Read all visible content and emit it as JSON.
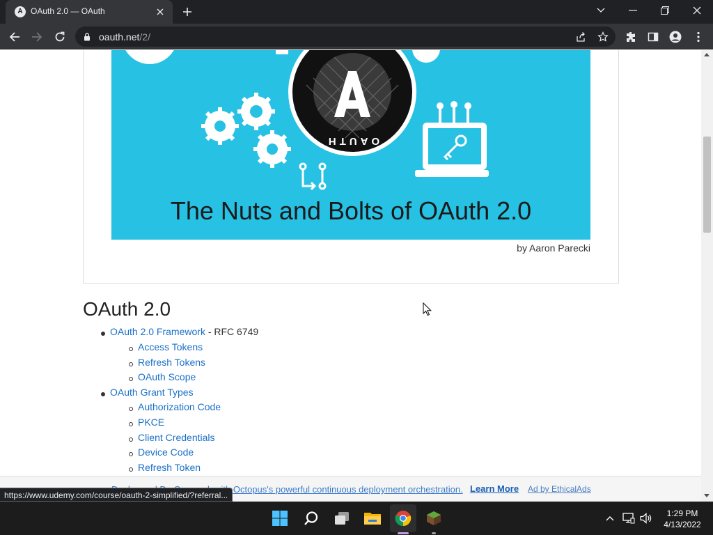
{
  "browser": {
    "tab": {
      "title": "OAuth 2.0 — OAuth",
      "favicon_letter": "A"
    },
    "address": {
      "domain": "oauth.net",
      "path": "/2/"
    }
  },
  "hero": {
    "title": "The Nuts and Bolts of OAuth 2.0",
    "badge_text": "OAUTH",
    "badge_letter": "A",
    "byline": "by Aaron Parecki"
  },
  "content": {
    "heading": "OAuth 2.0",
    "items": [
      {
        "label": "OAuth 2.0 Framework",
        "suffix": "- RFC 6749",
        "children": [
          "Access Tokens",
          "Refresh Tokens",
          "OAuth Scope"
        ]
      },
      {
        "label": "OAuth Grant Types",
        "children": [
          "Authorization Code",
          "PKCE",
          "Client Credentials",
          "Device Code",
          "Refresh Token"
        ]
      }
    ]
  },
  "ad": {
    "text": "Deploy and Do Ops work with Octopus's powerful continuous deployment orchestration.",
    "cta": "Learn More",
    "by": "Ad by EthicalAds"
  },
  "status_url": "https://www.udemy.com/course/oauth-2-simplified/?referral...",
  "taskbar": {
    "apps": [
      "start-icon",
      "search-icon",
      "task-view-icon",
      "file-explorer-icon",
      "chrome-icon",
      "minecraft-icon"
    ],
    "time": "1:29 PM",
    "date": "4/13/2022"
  },
  "colors": {
    "hero_bg": "#27c1e3",
    "link": "#1a70c7",
    "chrome_dark": "#202124",
    "chrome_tab": "#35363a"
  }
}
